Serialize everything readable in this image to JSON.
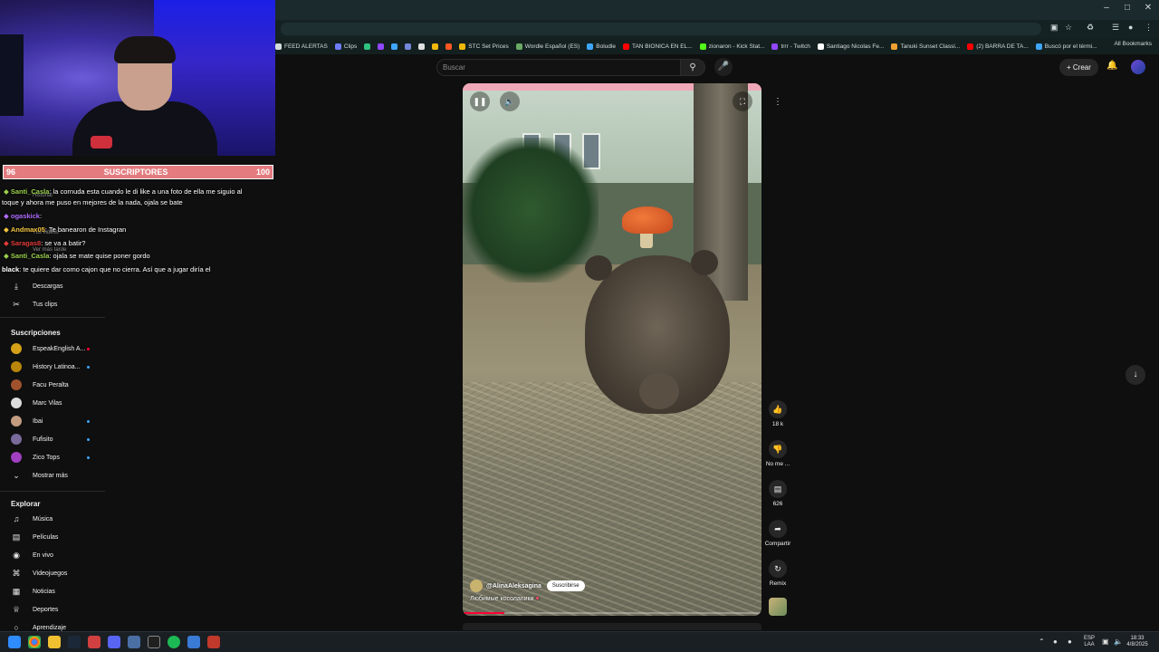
{
  "browser": {
    "bookmarks": [
      {
        "label": "FEED ALERTAS",
        "color": "#d6dcdc"
      },
      {
        "label": "Clips",
        "color": "#6e7cff"
      },
      {
        "label": "",
        "color": "#2ec27e"
      },
      {
        "label": "",
        "color": "#9146ff"
      },
      {
        "label": "",
        "color": "#3ea6ff"
      },
      {
        "label": "",
        "color": "#7289da"
      },
      {
        "label": "",
        "color": "#e0e0e0"
      },
      {
        "label": "",
        "color": "#f0b90b"
      },
      {
        "label": "",
        "color": "#ff5722"
      },
      {
        "label": "STC Set Prices",
        "color": "#f0b90b"
      },
      {
        "label": "Wordle Español (ES)",
        "color": "#6aaa64"
      },
      {
        "label": "Boludle",
        "color": "#3ea6ff"
      },
      {
        "label": "TAN BIONICA EN EL...",
        "color": "#ff0000"
      },
      {
        "label": "zionaron - Kick Stat...",
        "color": "#53fc18"
      },
      {
        "label": "trrr - Twitch",
        "color": "#9146ff"
      },
      {
        "label": "Santiago Nicolas Fe...",
        "color": "#ffffff"
      },
      {
        "label": "Tanuki Sunset Classi...",
        "color": "#f0a030"
      },
      {
        "label": "(2) BARRA DE TA...",
        "color": "#ff0000"
      },
      {
        "label": "Buscó por el térmi...",
        "color": "#3ea6ff"
      }
    ],
    "all_bookmarks_label": "All Bookmarks"
  },
  "youtube": {
    "search_placeholder": "Buscar",
    "create_label": "Crear"
  },
  "stream_overlay": {
    "sub_left": "96",
    "sub_title": "SUSCRIPTORES",
    "sub_right": "100",
    "chat": [
      {
        "user": "Santi_Casla",
        "user_color": "#9ad14b",
        "text": ": la cornuda esta cuando le di like a una foto de ella me siguio al"
      },
      {
        "user": "",
        "user_color": "#ffffff",
        "text": "toque y ahora me puso en mejores de la nada, ojala se bate"
      },
      {
        "user": "ogaskick",
        "user_color": "#b06cff",
        "text": ":"
      },
      {
        "user": "Andmax05",
        "user_color": "#f5c542",
        "text": ": Te banearon de Instagran"
      },
      {
        "user": "Saragas8",
        "user_color": "#e33a3a",
        "text": ": se va a batir?"
      },
      {
        "user": "Santi_Casla",
        "user_color": "#9ad14b",
        "text": ": ojala se mate quise poner gordo"
      },
      {
        "user": "black",
        "user_color": "#ffffff",
        "text": ": te quiere dar como cajon que no cierra. Así que a jugar diría el"
      }
    ]
  },
  "sidebar": {
    "faded_items": [
      "Historial",
      "Tus videos",
      "Ver más tarde"
    ],
    "items": [
      {
        "label": "Descargas",
        "icon": "download-icon"
      },
      {
        "label": "Tus clips",
        "icon": "scissors-icon"
      }
    ],
    "subs_heading": "Suscripciones",
    "subscriptions": [
      {
        "label": "EspeakEnglish A...",
        "avatar_color": "#d4a017",
        "live": true,
        "live_color": "#ff0033"
      },
      {
        "label": "History Latinoa...",
        "avatar_color": "#b8860b",
        "live": true,
        "live_color": "#3ea6ff"
      },
      {
        "label": "Facu Peralta",
        "avatar_color": "#a0522d",
        "live": false,
        "live_color": ""
      },
      {
        "label": "Marc Vilas",
        "avatar_color": "#dddddd",
        "live": false,
        "live_color": ""
      },
      {
        "label": "Ibai",
        "avatar_color": "#c29b80",
        "live": true,
        "live_color": "#3ea6ff"
      },
      {
        "label": "Fufisito",
        "avatar_color": "#7a6a9a",
        "live": true,
        "live_color": "#3ea6ff"
      },
      {
        "label": "Zico Tops",
        "avatar_color": "#a040c0",
        "live": true,
        "live_color": "#3ea6ff"
      }
    ],
    "show_more": "Mostrar más",
    "explore_heading": "Explorar",
    "explore": [
      {
        "label": "Música",
        "icon": "music-icon"
      },
      {
        "label": "Películas",
        "icon": "film-icon"
      },
      {
        "label": "En vivo",
        "icon": "live-icon"
      },
      {
        "label": "Videojuegos",
        "icon": "gamepad-icon"
      },
      {
        "label": "Noticias",
        "icon": "news-icon"
      },
      {
        "label": "Deportes",
        "icon": "trophy-icon"
      },
      {
        "label": "Aprendizaje",
        "icon": "learning-icon"
      }
    ]
  },
  "short": {
    "channel": "@AlinaAleksagina",
    "subscribe_label": "Suscribirse",
    "caption": "Любимые косолапики",
    "progress": 0.14
  },
  "actions": {
    "likes": "18 k",
    "dislike_label": "No me ...",
    "comments": "626",
    "share_label": "Compartir",
    "remix_label": "Remix"
  },
  "taskbar": {
    "lang_line1": "ESP",
    "lang_line2": "LAA",
    "time": "18:33",
    "date": "4/8/2025"
  }
}
